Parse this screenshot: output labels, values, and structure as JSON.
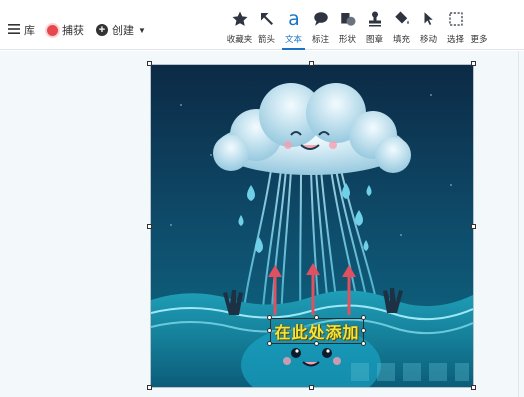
{
  "toolbar": {
    "library_label": "库",
    "capture_label": "捕获",
    "create_label": "创建",
    "tools": [
      {
        "label": "收藏夹",
        "icon": "star-icon"
      },
      {
        "label": "箭头",
        "icon": "arrow-icon"
      },
      {
        "label": "文本",
        "icon": "text-icon",
        "active": true
      },
      {
        "label": "标注",
        "icon": "callout-icon"
      },
      {
        "label": "形状",
        "icon": "shape-icon"
      },
      {
        "label": "图章",
        "icon": "stamp-icon"
      },
      {
        "label": "填充",
        "icon": "fill-icon"
      },
      {
        "label": "移动",
        "icon": "move-icon"
      },
      {
        "label": "选择",
        "icon": "select-icon"
      },
      {
        "label": "更多",
        "icon": "more-icon"
      }
    ]
  },
  "canvas": {
    "text_overlay": "在此处添加"
  },
  "colors": {
    "accent": "#1a73c7",
    "record": "#e5484d",
    "canvas_bg": "#f3f8fb",
    "overlay_text": "#f0e53b"
  }
}
